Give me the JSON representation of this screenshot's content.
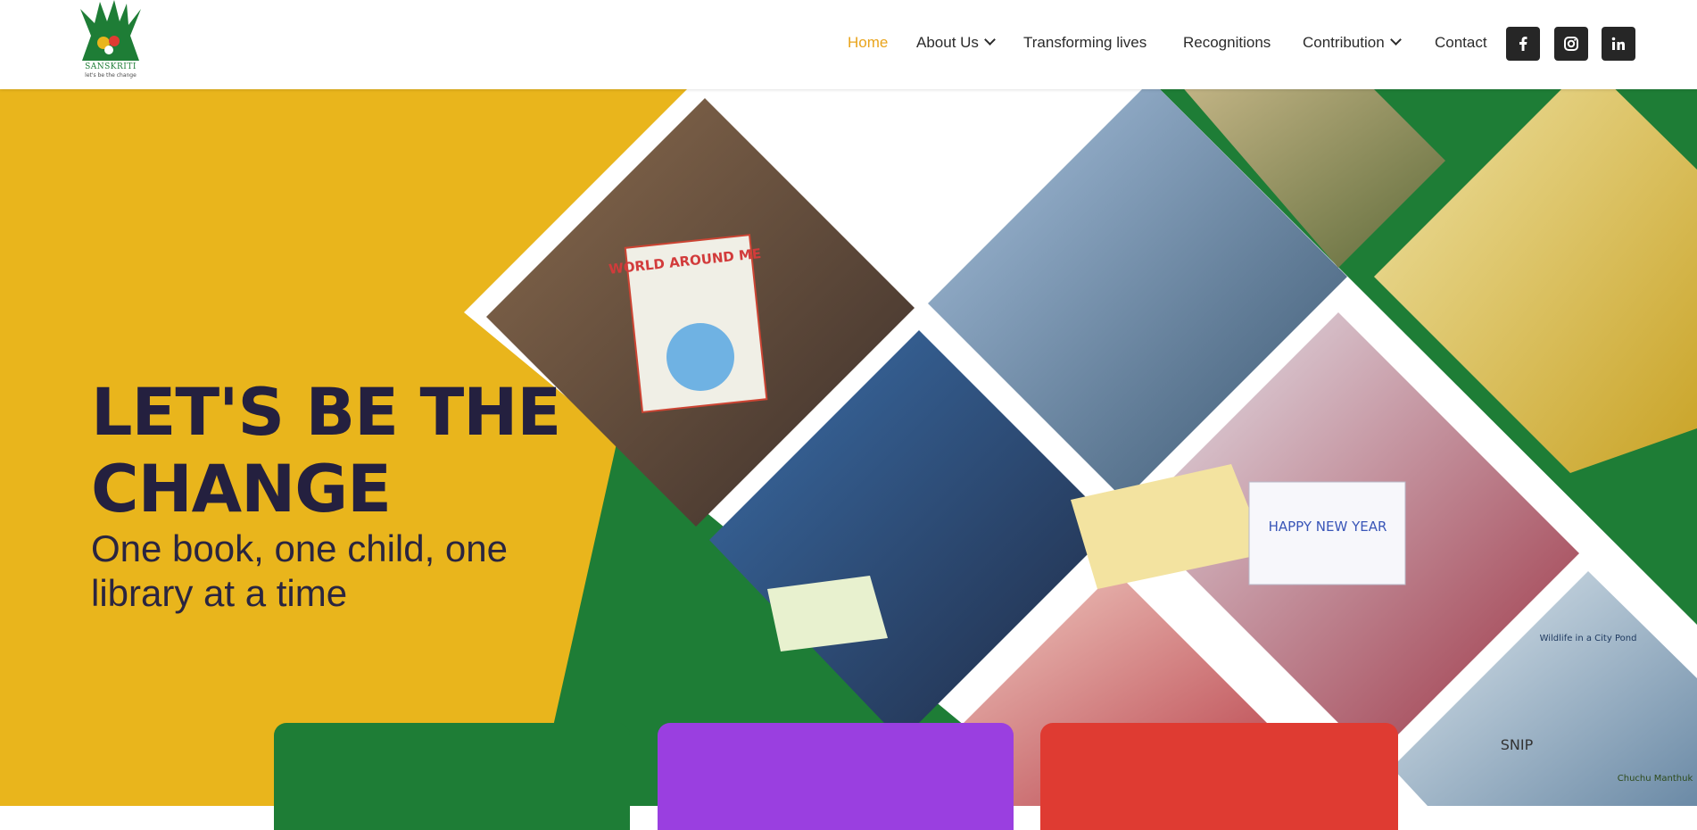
{
  "header": {
    "logo": {
      "name": "SANSKRITI",
      "tagline": "let's be the change"
    },
    "nav": [
      {
        "label": "Home",
        "active": true,
        "dropdown": false
      },
      {
        "label": "About Us",
        "active": false,
        "dropdown": true
      },
      {
        "label": "Transforming lives",
        "active": false,
        "dropdown": false
      },
      {
        "label": "Recognitions",
        "active": false,
        "dropdown": false
      },
      {
        "label": "Contribution",
        "active": false,
        "dropdown": true
      },
      {
        "label": "Contact",
        "active": false,
        "dropdown": false
      }
    ],
    "social": [
      "facebook-icon",
      "instagram-icon",
      "linkedin-icon"
    ]
  },
  "hero": {
    "headline": "LET'S BE THE CHANGE",
    "subheadline": "One book, one child, one library at a time",
    "colors": {
      "yellow": "#e9b51c",
      "green": "#1e7d36",
      "headline": "#24203f"
    },
    "photo_texts": [
      "WORLD AROUND ME",
      "HAPPY NEW YEAR",
      "Wildlife in a City Pond",
      "SNIP",
      "Chuchu Manthuk"
    ]
  },
  "cards": [
    {
      "color": "#1e7d36"
    },
    {
      "color": "#9a3fe0"
    },
    {
      "color": "#df3b32"
    }
  ]
}
